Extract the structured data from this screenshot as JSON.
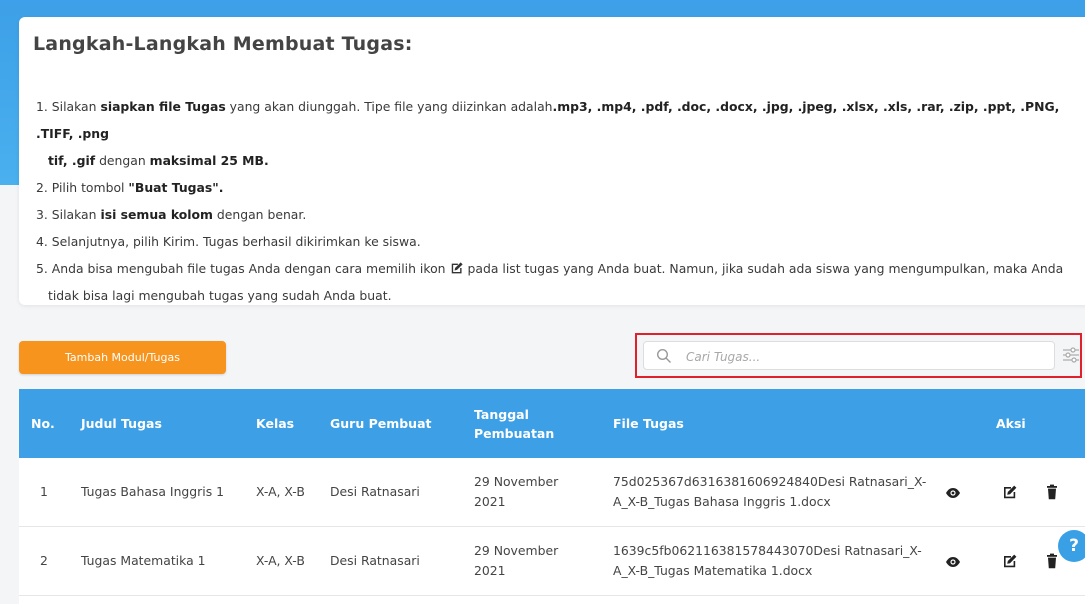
{
  "info": {
    "title": "Langkah-Langkah Membuat Tugas:",
    "step1_a": "1. Silakan ",
    "step1_b": "siapkan file Tugas",
    "step1_c": " yang akan diunggah. Tipe file yang diizinkan adalah",
    "step1_d": ".mp3, .mp4, .pdf, .doc, .docx, .jpg, .jpeg, .xlsx, .xls, .rar, .zip, .ppt, .PNG, .TIFF, .png",
    "step1_e": "tif, .gif",
    "step1_f": " dengan ",
    "step1_g": "maksimal 25 MB.",
    "step2_a": "2. Pilih tombol ",
    "step2_b": "\"Buat Tugas\".",
    "step3_a": "3. Silakan ",
    "step3_b": "isi semua kolom",
    "step3_c": " dengan benar.",
    "step4": "4. Selanjutnya, pilih Kirim. Tugas berhasil dikirimkan ke siswa.",
    "step5_a": "5. Anda bisa mengubah file tugas Anda dengan cara memilih ikon",
    "step5_b": "pada list tugas yang Anda buat. Namun, jika sudah ada siswa yang mengumpulkan, maka Anda",
    "step5_c": "tidak bisa lagi mengubah tugas yang sudah Anda buat."
  },
  "toolbar": {
    "add_label": "Tambah Modul/Tugas",
    "search_placeholder": "Cari Tugas..."
  },
  "table": {
    "headers": {
      "no": "No.",
      "judul": "Judul Tugas",
      "kelas": "Kelas",
      "guru": "Guru Pembuat",
      "tanggal": "Tanggal Pembuatan",
      "file": "File Tugas",
      "aksi": "Aksi"
    },
    "rows": [
      {
        "no": "1",
        "judul": "Tugas Bahasa Inggris 1",
        "kelas": "X-A, X-B",
        "guru": "Desi Ratnasari",
        "tanggal": "29 November 2021",
        "file": "75d025367d6316381606924840Desi Ratnasari_X-A_X-B_Tugas Bahasa Inggris 1.docx"
      },
      {
        "no": "2",
        "judul": "Tugas Matematika 1",
        "kelas": "X-A, X-B",
        "guru": "Desi Ratnasari",
        "tanggal": "29 November 2021",
        "file": "1639c5fb062116381578443070Desi Ratnasari_X-A_X-B_Tugas Matematika 1.docx"
      }
    ]
  },
  "help": {
    "label": "?"
  },
  "colors": {
    "primary": "#3d9fe6",
    "accent": "#f7941d",
    "highlight": "#e0202a"
  },
  "icons": [
    "search-icon",
    "filter-icon",
    "view-icon",
    "edit-icon",
    "delete-icon",
    "help-icon"
  ]
}
